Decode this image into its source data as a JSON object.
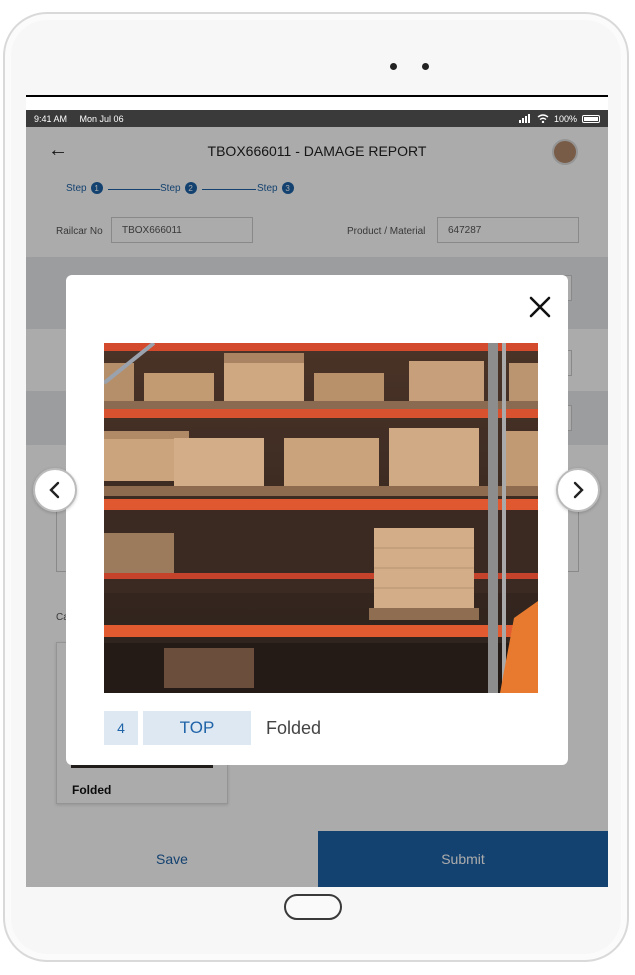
{
  "status_bar": {
    "time": "9:41 AM",
    "date": "Mon Jul 06",
    "battery": "100%"
  },
  "header": {
    "title": "TBOX666011 - DAMAGE REPORT"
  },
  "stepper": {
    "steps": [
      {
        "label": "Step",
        "num": "1"
      },
      {
        "label": "Step",
        "num": "2"
      },
      {
        "label": "Step",
        "num": "3"
      }
    ]
  },
  "form": {
    "railcar_label": "Railcar No",
    "railcar_value": "TBOX666011",
    "product_label": "Product / Material",
    "product_value": "647287"
  },
  "background_section": {
    "label_fragment": "Ca"
  },
  "thumbnail": {
    "label": "Folded"
  },
  "actions": {
    "save": "Save",
    "submit": "Submit"
  },
  "modal": {
    "index": "4",
    "position": "TOP",
    "damage": "Folded"
  },
  "colors": {
    "accent": "#1f63a8",
    "caption_bg": "#dde8f2"
  }
}
